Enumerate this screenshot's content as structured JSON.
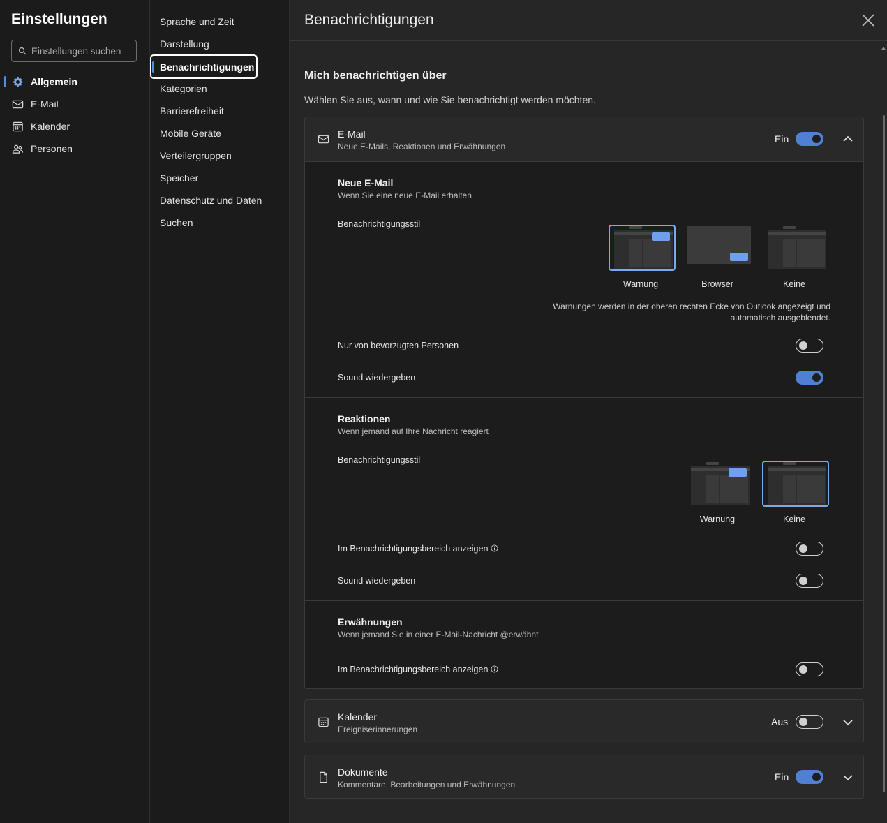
{
  "app": {
    "title": "Einstellungen",
    "search_placeholder": "Einstellungen suchen"
  },
  "nav": [
    {
      "label": "Allgemein",
      "icon": "gear-icon",
      "active": true
    },
    {
      "label": "E-Mail",
      "icon": "mail-icon"
    },
    {
      "label": "Kalender",
      "icon": "calendar-icon"
    },
    {
      "label": "Personen",
      "icon": "people-icon"
    }
  ],
  "subnav": [
    "Sprache und Zeit",
    "Darstellung",
    "Benachrichtigungen",
    "Kategorien",
    "Barrierefreiheit",
    "Mobile Geräte",
    "Verteilergruppen",
    "Speicher",
    "Datenschutz und Daten",
    "Suchen"
  ],
  "page": {
    "title": "Benachrichtigungen",
    "section_title": "Mich benachrichtigen über",
    "section_desc": "Wählen Sie aus, wann und wie Sie benachrichtigt werden möchten."
  },
  "email_card": {
    "title": "E-Mail",
    "subtitle": "Neue E-Mails, Reaktionen und Erwähnungen",
    "state": "Ein",
    "new_mail": {
      "title": "Neue E-Mail",
      "desc": "Wenn Sie eine neue E-Mail erhalten",
      "style_label": "Benachrichtigungsstil",
      "styles": [
        "Warnung",
        "Browser",
        "Keine"
      ],
      "selected": "Warnung",
      "hint": "Warnungen werden in der oberen rechten Ecke von Outlook angezeigt und automatisch ausgeblendet.",
      "favorites_label": "Nur von bevorzugten Personen",
      "favorites_on": false,
      "sound_label": "Sound wiedergeben",
      "sound_on": true
    },
    "reactions": {
      "title": "Reaktionen",
      "desc": "Wenn jemand auf Ihre Nachricht reagiert",
      "style_label": "Benachrichtigungsstil",
      "styles": [
        "Warnung",
        "Keine"
      ],
      "selected": "Keine",
      "area_label": "Im Benachrichtigungsbereich anzeigen",
      "area_on": false,
      "sound_label": "Sound wiedergeben",
      "sound_on": false
    },
    "mentions": {
      "title": "Erwähnungen",
      "desc": "Wenn jemand Sie in einer E-Mail-Nachricht @erwähnt",
      "area_label": "Im Benachrichtigungsbereich anzeigen",
      "area_on": false
    }
  },
  "calendar_card": {
    "title": "Kalender",
    "subtitle": "Ereigniserinnerungen",
    "state": "Aus"
  },
  "documents_card": {
    "title": "Dokumente",
    "subtitle": "Kommentare, Bearbeitungen und Erwähnungen",
    "state": "Ein"
  },
  "colors": {
    "accent": "#4f80d3",
    "selected_border": "#7aa9ec",
    "popup": "#6ea0ec"
  }
}
